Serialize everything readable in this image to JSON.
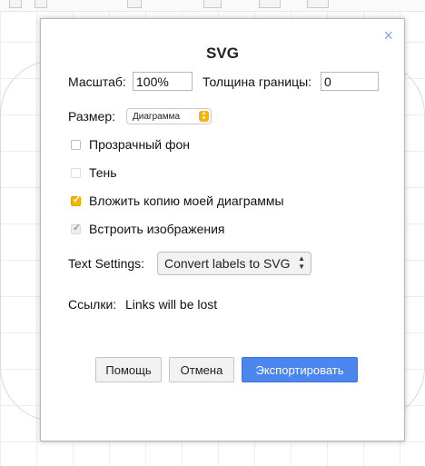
{
  "dialog": {
    "title": "SVG",
    "close_glyph": "×",
    "zoom": {
      "label": "Масштаб:",
      "value": "100%"
    },
    "border": {
      "label": "Толщина границы:",
      "value": "0"
    },
    "size": {
      "label": "Размер:",
      "selected": "Диаграмма"
    },
    "checkboxes": [
      {
        "label": "Прозрачный фон",
        "checked": false
      },
      {
        "label": "Тень",
        "checked": false
      },
      {
        "label": "Вложить копию моей диаграммы",
        "checked": true
      },
      {
        "label": "Встроить изображения",
        "checked": true
      }
    ],
    "text_settings": {
      "label": "Text Settings:",
      "selected": "Convert labels to SVG"
    },
    "links": {
      "label": "Ссылки:",
      "value": "Links will be lost"
    },
    "buttons": {
      "help": "Помощь",
      "cancel": "Отмена",
      "export": "Экспортировать"
    }
  },
  "colors": {
    "accent": "#4a86ee",
    "checkbox_checked": "#f4b400",
    "close": "#8fa6c9"
  }
}
